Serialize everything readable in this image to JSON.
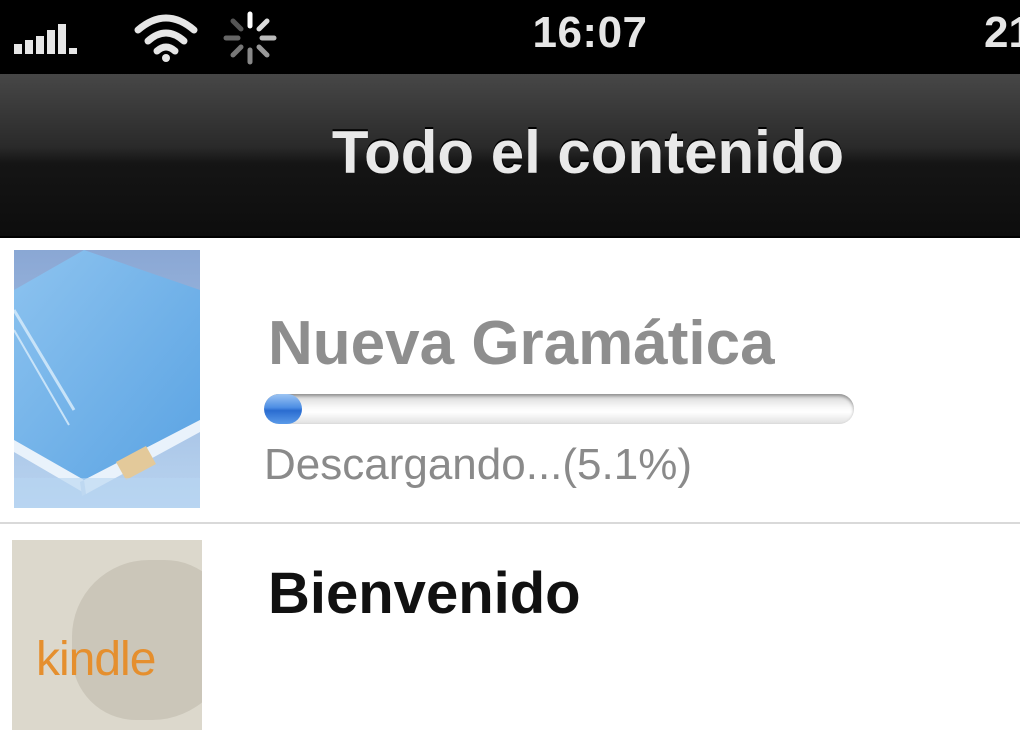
{
  "status_bar": {
    "time": "16:07",
    "battery_text": "21",
    "icons": [
      "signal-bars-icon",
      "wifi-icon",
      "activity-spinner-icon"
    ]
  },
  "nav": {
    "title": "Todo el contenido"
  },
  "items": [
    {
      "title": "Nueva Gramática",
      "status": "Descargando...(5.1%)",
      "progress_percent": 5.1,
      "cover": "generic-book-icon",
      "downloading": true
    },
    {
      "title": "Bienvenido",
      "cover_logo": "kindle",
      "cover": "kindle-cover"
    }
  ],
  "colors": {
    "progress_fill": "#2a6cd0",
    "kindle_orange": "#e58f2e",
    "nav_bar": "#1a1a1a"
  }
}
